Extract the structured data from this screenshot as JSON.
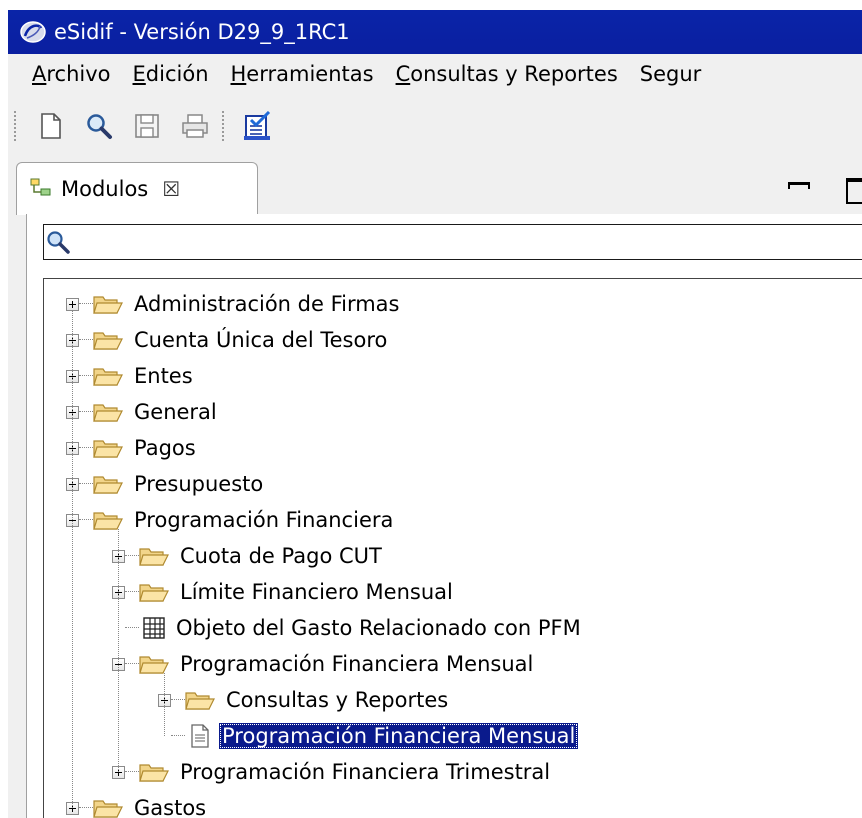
{
  "window": {
    "title": "eSidif - Versión D29_9_1RC1",
    "accent": "#0a24a8"
  },
  "menu": [
    {
      "mnemonic": "A",
      "rest": "rchivo"
    },
    {
      "mnemonic": "E",
      "rest": "dición"
    },
    {
      "mnemonic": "H",
      "rest": "erramientas"
    },
    {
      "mnemonic": "C",
      "rest": "onsultas y Reportes"
    },
    {
      "mnemonic": "",
      "rest": "Segur"
    }
  ],
  "toolbar": {
    "icons": [
      "new-document-icon",
      "search-icon",
      "save-icon",
      "print-icon",
      "checklist-icon"
    ]
  },
  "view": {
    "tab_label": "Modulos",
    "tab_close": "☒",
    "filter_value": "",
    "filter_placeholder": ""
  },
  "tree": [
    {
      "label": "Administración de Firmas",
      "level": 0,
      "expander": "plus",
      "icon": "folder"
    },
    {
      "label": "Cuenta Única del Tesoro",
      "level": 0,
      "expander": "plus",
      "icon": "folder"
    },
    {
      "label": "Entes",
      "level": 0,
      "expander": "plus",
      "icon": "folder"
    },
    {
      "label": "General",
      "level": 0,
      "expander": "plus",
      "icon": "folder"
    },
    {
      "label": "Pagos",
      "level": 0,
      "expander": "plus",
      "icon": "folder"
    },
    {
      "label": "Presupuesto",
      "level": 0,
      "expander": "plus",
      "icon": "folder"
    },
    {
      "label": "Programación Financiera",
      "level": 0,
      "expander": "minus",
      "icon": "folder"
    },
    {
      "label": "Cuota de Pago CUT",
      "level": 1,
      "expander": "plus",
      "icon": "folder"
    },
    {
      "label": "Límite Financiero Mensual",
      "level": 1,
      "expander": "plus",
      "icon": "folder"
    },
    {
      "label": "Objeto del Gasto Relacionado con PFM",
      "level": 1,
      "expander": "none",
      "icon": "grid"
    },
    {
      "label": "Programación Financiera Mensual",
      "level": 1,
      "expander": "minus",
      "icon": "folder"
    },
    {
      "label": "Consultas y Reportes",
      "level": 2,
      "expander": "plus",
      "icon": "folder"
    },
    {
      "label": "Programación Financiera Mensual",
      "level": 2,
      "expander": "none",
      "icon": "document",
      "selected": true
    },
    {
      "label": "Programación Financiera Trimestral",
      "level": 1,
      "expander": "plus",
      "icon": "folder"
    },
    {
      "label": "Gastos",
      "level": 0,
      "expander": "plus",
      "icon": "folder"
    }
  ]
}
